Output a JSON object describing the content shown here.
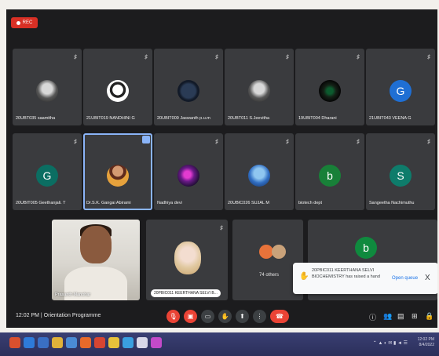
{
  "recording": {
    "label": "REC"
  },
  "row1": [
    {
      "name": "20UBT035 saamitha",
      "avatar": "photo"
    },
    {
      "name": "21UBIT019 NANDHINI G",
      "avatar": "panda"
    },
    {
      "name": "20UBIT009 Jaswanth p.u.m",
      "avatar": "logo"
    },
    {
      "name": "20UBT011 S.Jeevitha",
      "avatar": "photo"
    },
    {
      "name": "19UBIT004 Dharani",
      "avatar": "dark"
    },
    {
      "name": "21UBIT043 VEENA G",
      "letter": "G",
      "color": "#1f6fd4"
    }
  ],
  "row2": [
    {
      "name": "20UBIT005 Geethanjali. T",
      "letter": "G",
      "color": "#0b6e62"
    },
    {
      "name": "Dr.S.K. Gangai Abirami",
      "avatar": "woman"
    },
    {
      "name": "Nadhiya devi",
      "avatar": "flower"
    },
    {
      "name": "20UBIC026 SUJAL M",
      "avatar": "blue"
    },
    {
      "name": "biotech dept",
      "letter": "b",
      "color": "#188038"
    },
    {
      "name": "Sangeetha Nachimuthu",
      "letter": "S",
      "color": "#0e7c6b"
    }
  ],
  "row3": {
    "video_name": "Prasanth Manohar",
    "pill_name": "20PBIC011 KEERTHANA SELVI B...",
    "others": "74 others",
    "letter": "b"
  },
  "toast": {
    "message": "20PBIC011 KEERTHANA SELVI BIOCHEMISTRY has raised a hand",
    "action": "Open queue",
    "close": "X"
  },
  "bottom_bar": {
    "time_title": "12:02 PM | Orientation Programme"
  },
  "taskbar": {
    "clock_time": "12:02 PM",
    "clock_date": "8/4/2022"
  }
}
